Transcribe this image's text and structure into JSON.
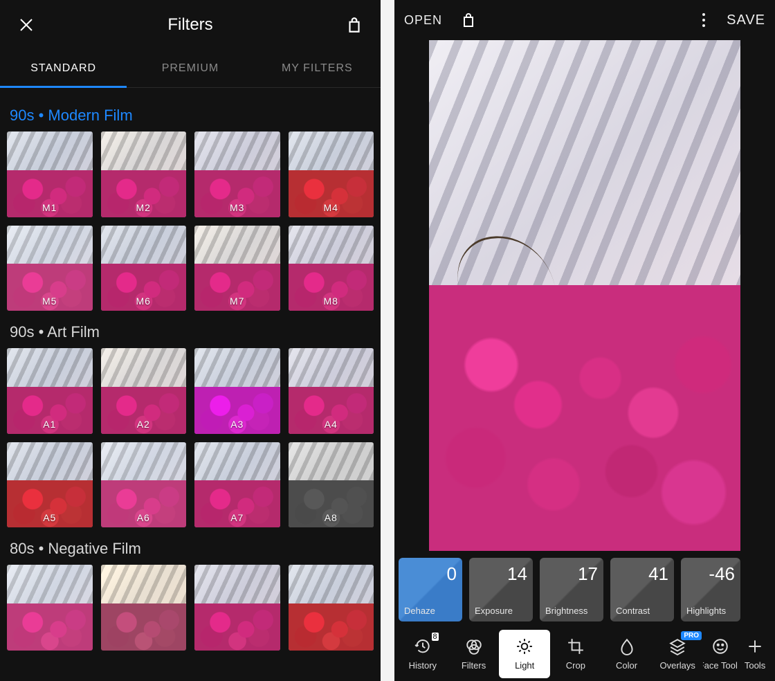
{
  "left": {
    "title": "Filters",
    "tabs": [
      "STANDARD",
      "PREMIUM",
      "MY FILTERS"
    ],
    "active_tab": 0,
    "sections": [
      {
        "title": "90s • Modern Film",
        "accent": true,
        "filters": [
          {
            "label": "M1",
            "variant": ""
          },
          {
            "label": "M2",
            "variant": "warm"
          },
          {
            "label": "M3",
            "variant": "cool"
          },
          {
            "label": "M4",
            "variant": "purple"
          },
          {
            "label": "M5",
            "variant": "fade"
          },
          {
            "label": "M6",
            "variant": ""
          },
          {
            "label": "M7",
            "variant": "warm"
          },
          {
            "label": "M8",
            "variant": "cool"
          }
        ]
      },
      {
        "title": "90s • Art Film",
        "accent": false,
        "filters": [
          {
            "label": "A1",
            "variant": ""
          },
          {
            "label": "A2",
            "variant": "warm"
          },
          {
            "label": "A3",
            "variant": "red"
          },
          {
            "label": "A4",
            "variant": "cool"
          },
          {
            "label": "A5",
            "variant": "purple"
          },
          {
            "label": "A6",
            "variant": "fade"
          },
          {
            "label": "A7",
            "variant": ""
          },
          {
            "label": "A8",
            "variant": "bw"
          }
        ]
      },
      {
        "title": "80s • Negative Film",
        "accent": false,
        "filters": [
          {
            "label": "",
            "variant": "fade"
          },
          {
            "label": "",
            "variant": "sepia"
          },
          {
            "label": "",
            "variant": "cool"
          },
          {
            "label": "",
            "variant": "purple"
          }
        ]
      }
    ]
  },
  "right": {
    "open": "OPEN",
    "save": "SAVE",
    "adjustments": [
      {
        "label": "Dehaze",
        "value": "0",
        "active": true
      },
      {
        "label": "Exposure",
        "value": "14",
        "active": false
      },
      {
        "label": "Brightness",
        "value": "17",
        "active": false
      },
      {
        "label": "Contrast",
        "value": "41",
        "active": false
      },
      {
        "label": "Highlights",
        "value": "-46",
        "active": false
      }
    ],
    "history_count": "8",
    "pro_badge": "PRO",
    "tools": [
      {
        "label": "History",
        "icon": "history",
        "badge": "count"
      },
      {
        "label": "Filters",
        "icon": "filters"
      },
      {
        "label": "Light",
        "icon": "light",
        "active": true
      },
      {
        "label": "Crop",
        "icon": "crop"
      },
      {
        "label": "Color",
        "icon": "color"
      },
      {
        "label": "Overlays",
        "icon": "overlays",
        "badge": "pro"
      },
      {
        "label": "Face Tools",
        "icon": "face",
        "clip": true
      },
      {
        "label": "Tools",
        "icon": "tools",
        "clip": true
      }
    ]
  }
}
